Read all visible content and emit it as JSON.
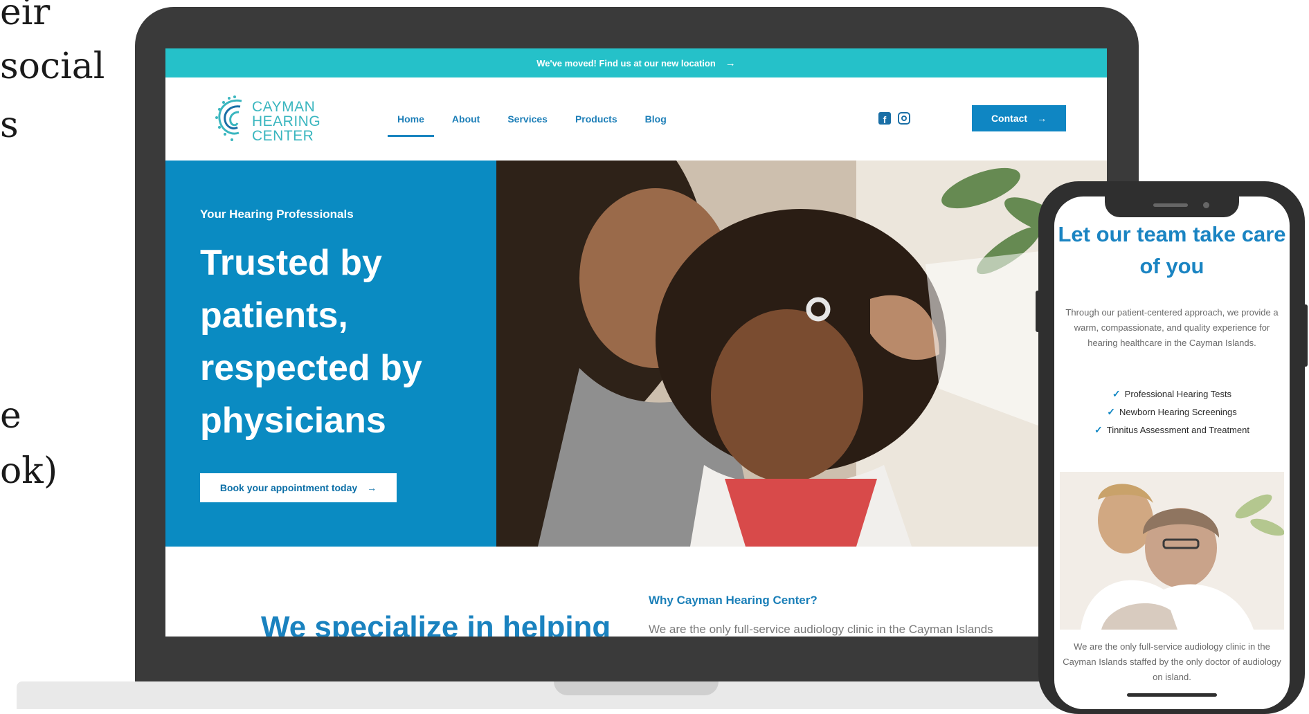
{
  "side_text": [
    "eir",
    "social",
    "s",
    "e",
    "ok)"
  ],
  "laptop": {
    "announcement": "We've moved! Find us at our new location",
    "logo_lines": [
      "CAYMAN",
      "HEARING",
      "CENTER"
    ],
    "nav": [
      "Home",
      "About",
      "Services",
      "Products",
      "Blog"
    ],
    "active_nav": "Home",
    "contact_label": "Contact",
    "hero": {
      "eyebrow": "Your Hearing Professionals",
      "title_lines": [
        "Trusted by",
        "patients,",
        "respected by",
        "physicians"
      ],
      "cta": "Book your appointment today"
    },
    "why_heading": "Why Cayman Hearing Center?",
    "specialize_heading": "We specialize in helping",
    "only_text": "We are the only full-service audiology clinic in the Cayman Islands"
  },
  "phone": {
    "title": "Let our team take care of you",
    "body": "Through our patient-centered approach, we provide a warm, compassionate, and quality experience for hearing healthcare in the Cayman Islands.",
    "list": [
      "Professional Hearing Tests",
      "Newborn Hearing Screenings",
      "Tinnitus Assessment and Treatment"
    ],
    "footer": "We are the only full-service audiology clinic in the Cayman Islands staffed by the only doctor of audiology on island."
  },
  "colors": {
    "teal": "#25c1c9",
    "blue": "#0a8bc2",
    "link": "#1d7fb8"
  }
}
